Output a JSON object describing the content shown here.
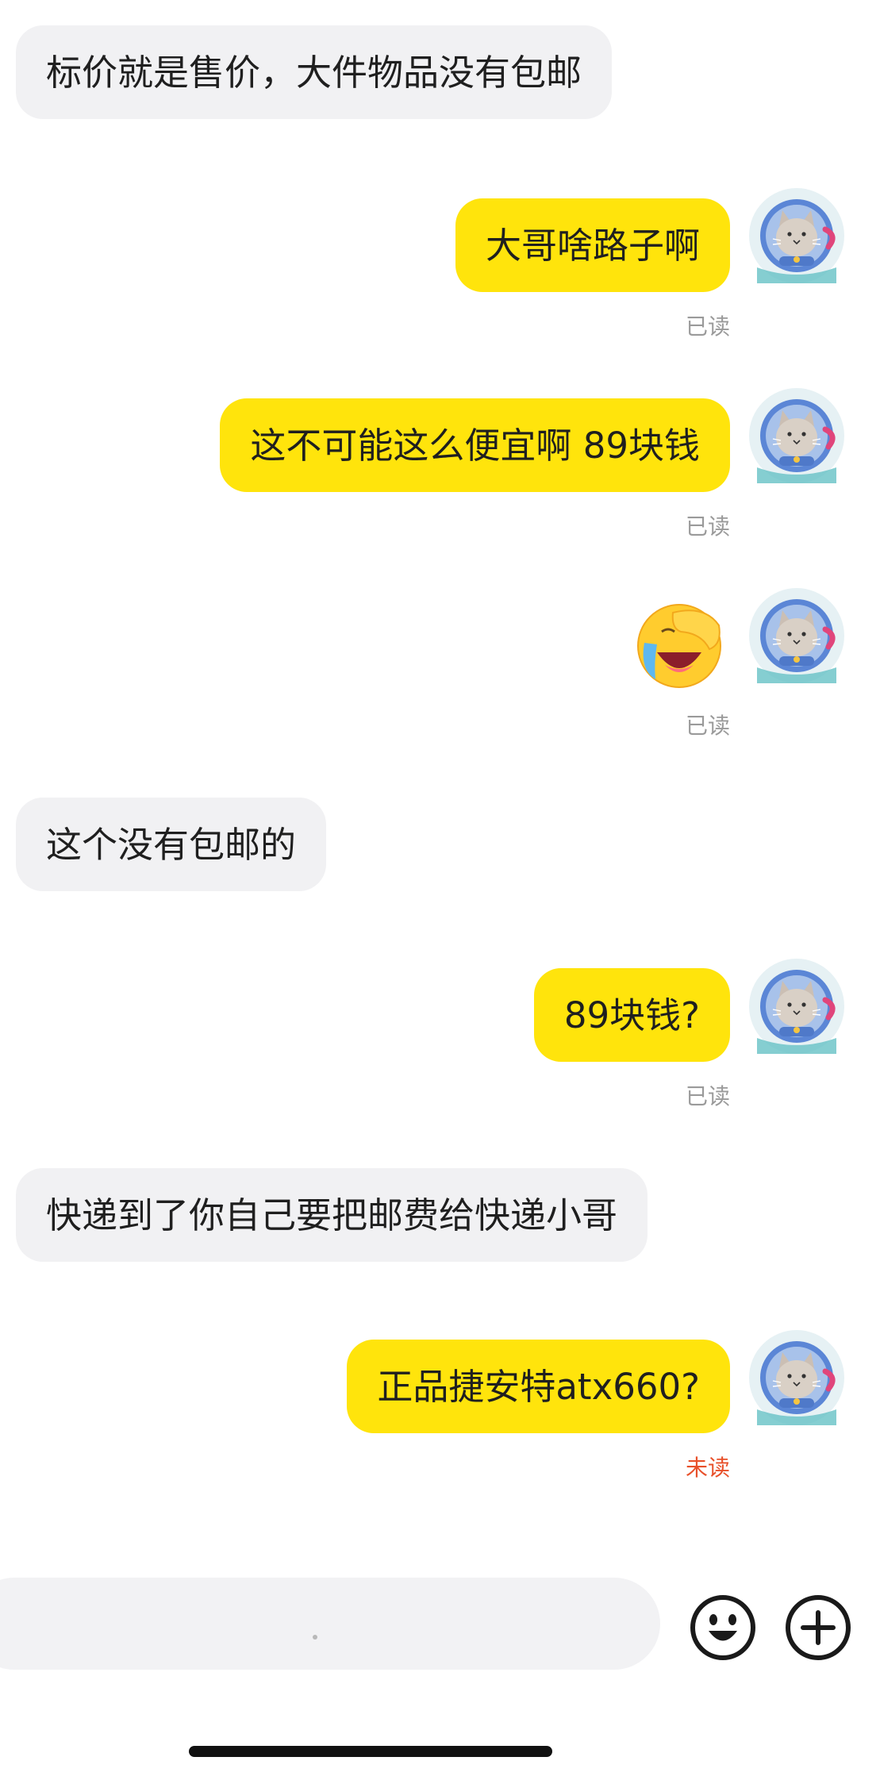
{
  "colors": {
    "outgoing_bubble": "#ffe40c",
    "incoming_bubble": "#f1f1f3",
    "read_status": "#9a9a9a",
    "unread_status": "#e8502a"
  },
  "messages": [
    {
      "id": "m1",
      "direction": "incoming",
      "text": "标价就是售价，大件物品没有包邮"
    },
    {
      "id": "m2",
      "direction": "outgoing",
      "text": "大哥啥路子啊",
      "status": "已读",
      "avatar": "cat-astronaut-avatar"
    },
    {
      "id": "m3",
      "direction": "outgoing",
      "text": "这不可能这么便宜啊  89块钱",
      "status": "已读",
      "avatar": "cat-astronaut-avatar"
    },
    {
      "id": "m4",
      "direction": "outgoing",
      "emoji": "facepalm-crying-emoji",
      "status": "已读",
      "avatar": "cat-astronaut-avatar"
    },
    {
      "id": "m5",
      "direction": "incoming",
      "text": "这个没有包邮的"
    },
    {
      "id": "m6",
      "direction": "outgoing",
      "text": "89块钱?",
      "status": "已读",
      "avatar": "cat-astronaut-avatar"
    },
    {
      "id": "m7",
      "direction": "incoming",
      "text": "快递到了你自己要把邮费给快递小哥"
    },
    {
      "id": "m8",
      "direction": "outgoing",
      "text": "正品捷安特atx660?",
      "status": "未读",
      "avatar": "cat-astronaut-avatar"
    }
  ],
  "composer": {
    "input_value": "",
    "icons": [
      "smiley-icon",
      "plus-icon"
    ]
  }
}
